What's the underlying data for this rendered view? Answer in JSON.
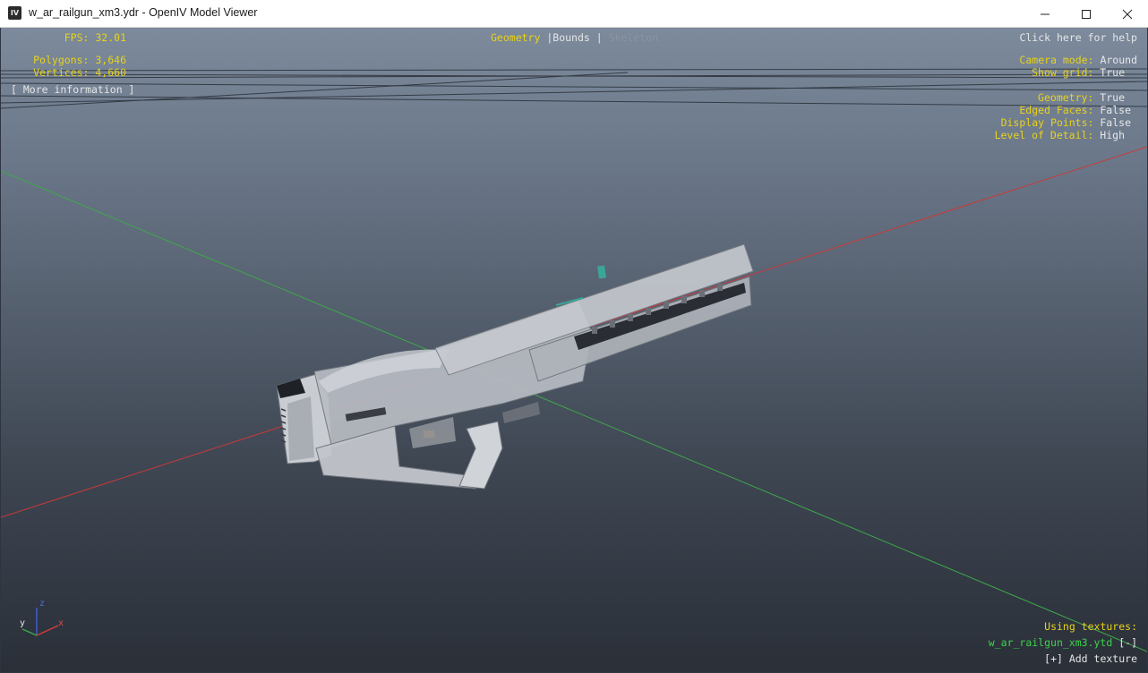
{
  "window": {
    "title": "w_ar_railgun_xm3.ydr - OpenIV Model Viewer",
    "icon_label": "IV"
  },
  "stats": {
    "fps_label": "FPS:",
    "fps_value": "32.01",
    "polygons_label": "Polygons:",
    "polygons_value": "3,646",
    "vertices_label": "Vertices:",
    "vertices_value": "4,660",
    "more_info": "[ More information ]"
  },
  "view_modes": {
    "geometry": "Geometry",
    "sep1": "|",
    "bounds": "Bounds",
    "sep2": "|",
    "skeleton": "Skeleton"
  },
  "help": {
    "label": "Click here for help"
  },
  "settings": [
    {
      "label": "Camera mode:",
      "value": "Around"
    },
    {
      "label": "Show grid:",
      "value": "True"
    },
    {
      "label": "Geometry:",
      "value": "True"
    },
    {
      "label": "Edged Faces:",
      "value": "False"
    },
    {
      "label": "Display Points:",
      "value": "False"
    },
    {
      "label": "Level of Detail:",
      "value": "High"
    }
  ],
  "textures": {
    "heading": "Using textures:",
    "files": [
      {
        "name": "w_ar_railgun_xm3.ytd",
        "remove": "[-]"
      }
    ],
    "add": "[+] Add texture"
  },
  "axes": {
    "x": "x",
    "y": "y",
    "z": "z"
  },
  "colors": {
    "hud_yellow": "#e8d21c",
    "hud_white": "#e6e6e6",
    "texture_green": "#3ed24a",
    "axis_red": "#d23c3c",
    "axis_green": "#3ea84a",
    "axis_blue": "#3c5ad2"
  }
}
